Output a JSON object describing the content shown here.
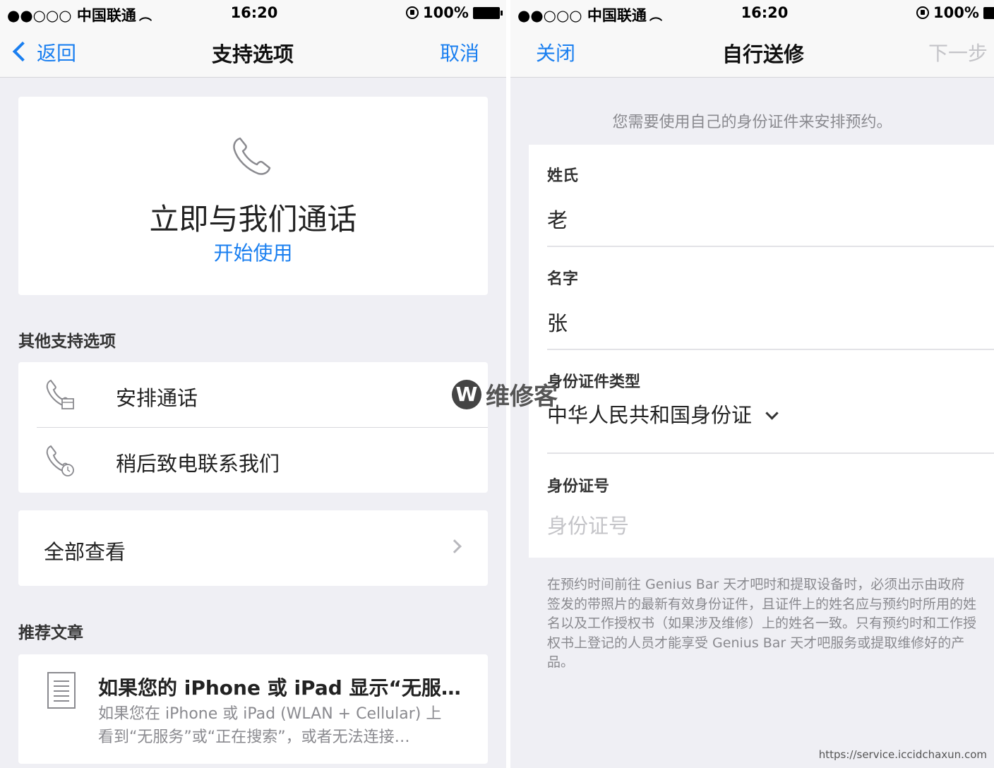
{
  "status_bar": {
    "carrier": "●●○○○ 中国联通",
    "time": "16:20",
    "battery": "100%"
  },
  "left_screen": {
    "nav": {
      "back_label": "返回",
      "title": "支持选项",
      "cancel_label": "取消"
    },
    "call_card": {
      "title": "立即与我们通话",
      "link": "开始使用"
    },
    "other_header": "其他支持选项",
    "options": [
      {
        "label": "安排通话",
        "icon": "phone-schedule-icon"
      },
      {
        "label": "稍后致电联系我们",
        "icon": "phone-clock-icon"
      }
    ],
    "view_all": "全部查看",
    "recommended_header": "推荐文章",
    "article": {
      "title": "如果您的 iPhone 或 iPad 显示“无服…",
      "desc_line1": "如果您在 iPhone 或 iPad (WLAN + Cellular) 上",
      "desc_line2": "看到“无服务”或“正在搜索”，或者无法连接…"
    }
  },
  "right_screen": {
    "nav": {
      "close_label": "关闭",
      "title": "自行送修",
      "next_label": "下一步"
    },
    "hint": "您需要使用自己的身份证件来安排预约。",
    "fields": {
      "surname": {
        "label": "姓氏",
        "value": "老"
      },
      "given_name": {
        "label": "名字",
        "value": "张"
      },
      "id_type": {
        "label": "身份证件类型",
        "value": "中华人民共和国身份证"
      },
      "id_number": {
        "label": "身份证号",
        "placeholder": "身份证号"
      }
    },
    "footnote": "在预约时间前往 Genius Bar 天才吧时和提取设备时，必须出示由政府签发的带照片的最新有效身份证件，且证件上的姓名应与预约时所用的姓名以及工作授权书（如果涉及维修）上的姓名一致。只有预约时和工作授权书上登记的人员才能享受 Genius Bar 天才吧服务或提取维修好的产品。"
  },
  "watermark": {
    "letter": "W",
    "text": "维修客"
  },
  "source_url": "https://service.iccidchaxun.com",
  "colors": {
    "accent": "#1a7ff0",
    "background": "#efeff4",
    "disabled": "#c4c4c8"
  }
}
